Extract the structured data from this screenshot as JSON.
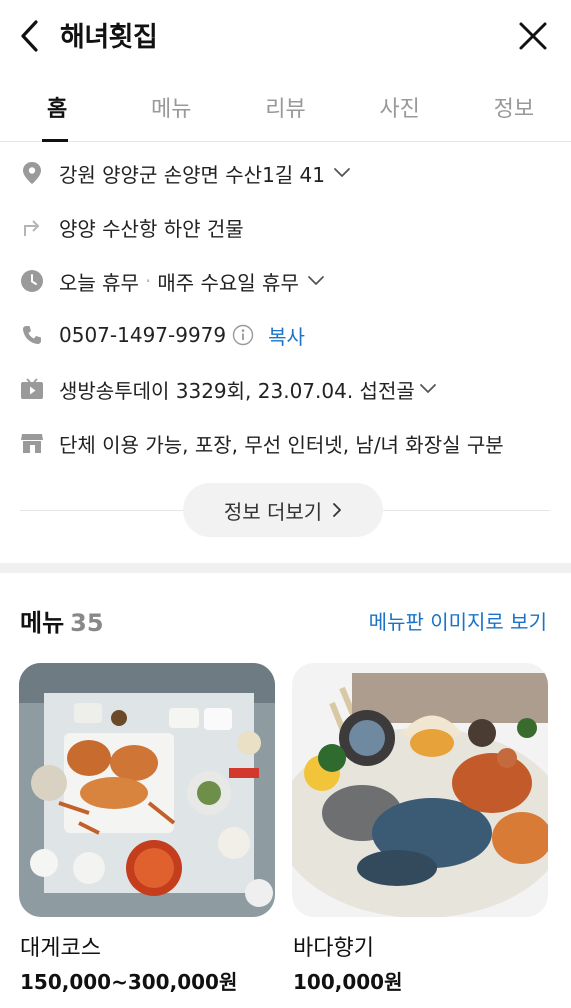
{
  "header": {
    "title": "해녀횟집"
  },
  "tabs": [
    {
      "label": "홈"
    },
    {
      "label": "메뉴"
    },
    {
      "label": "리뷰"
    },
    {
      "label": "사진"
    },
    {
      "label": "정보"
    }
  ],
  "active_tab": "홈",
  "info": {
    "address": "강원 양양군 손양면 수산1길 41",
    "directions": "양양 수산항 하얀 건물",
    "hours_status": "오늘 휴무",
    "hours_dot": "·",
    "hours_detail": "매주 수요일 휴무",
    "phone": "0507-1497-9979",
    "copy_label": "복사",
    "tv": "생방송투데이 3329회, 23.07.04. 섭전골",
    "amenities": "단체 이용 가능, 포장, 무선 인터넷, 남/녀 화장실 구분"
  },
  "more_button": "정보 더보기",
  "menu": {
    "title": "메뉴",
    "count": "35",
    "board_link": "메뉴판 이미지로 보기",
    "items": [
      {
        "name": "대게코스",
        "price": "150,000~300,000원"
      },
      {
        "name": "바다향기",
        "price": "100,000원"
      }
    ]
  },
  "colors": {
    "link": "#1a73c8",
    "icon": "#9a9a9a",
    "divider": "#e6e6e6"
  }
}
